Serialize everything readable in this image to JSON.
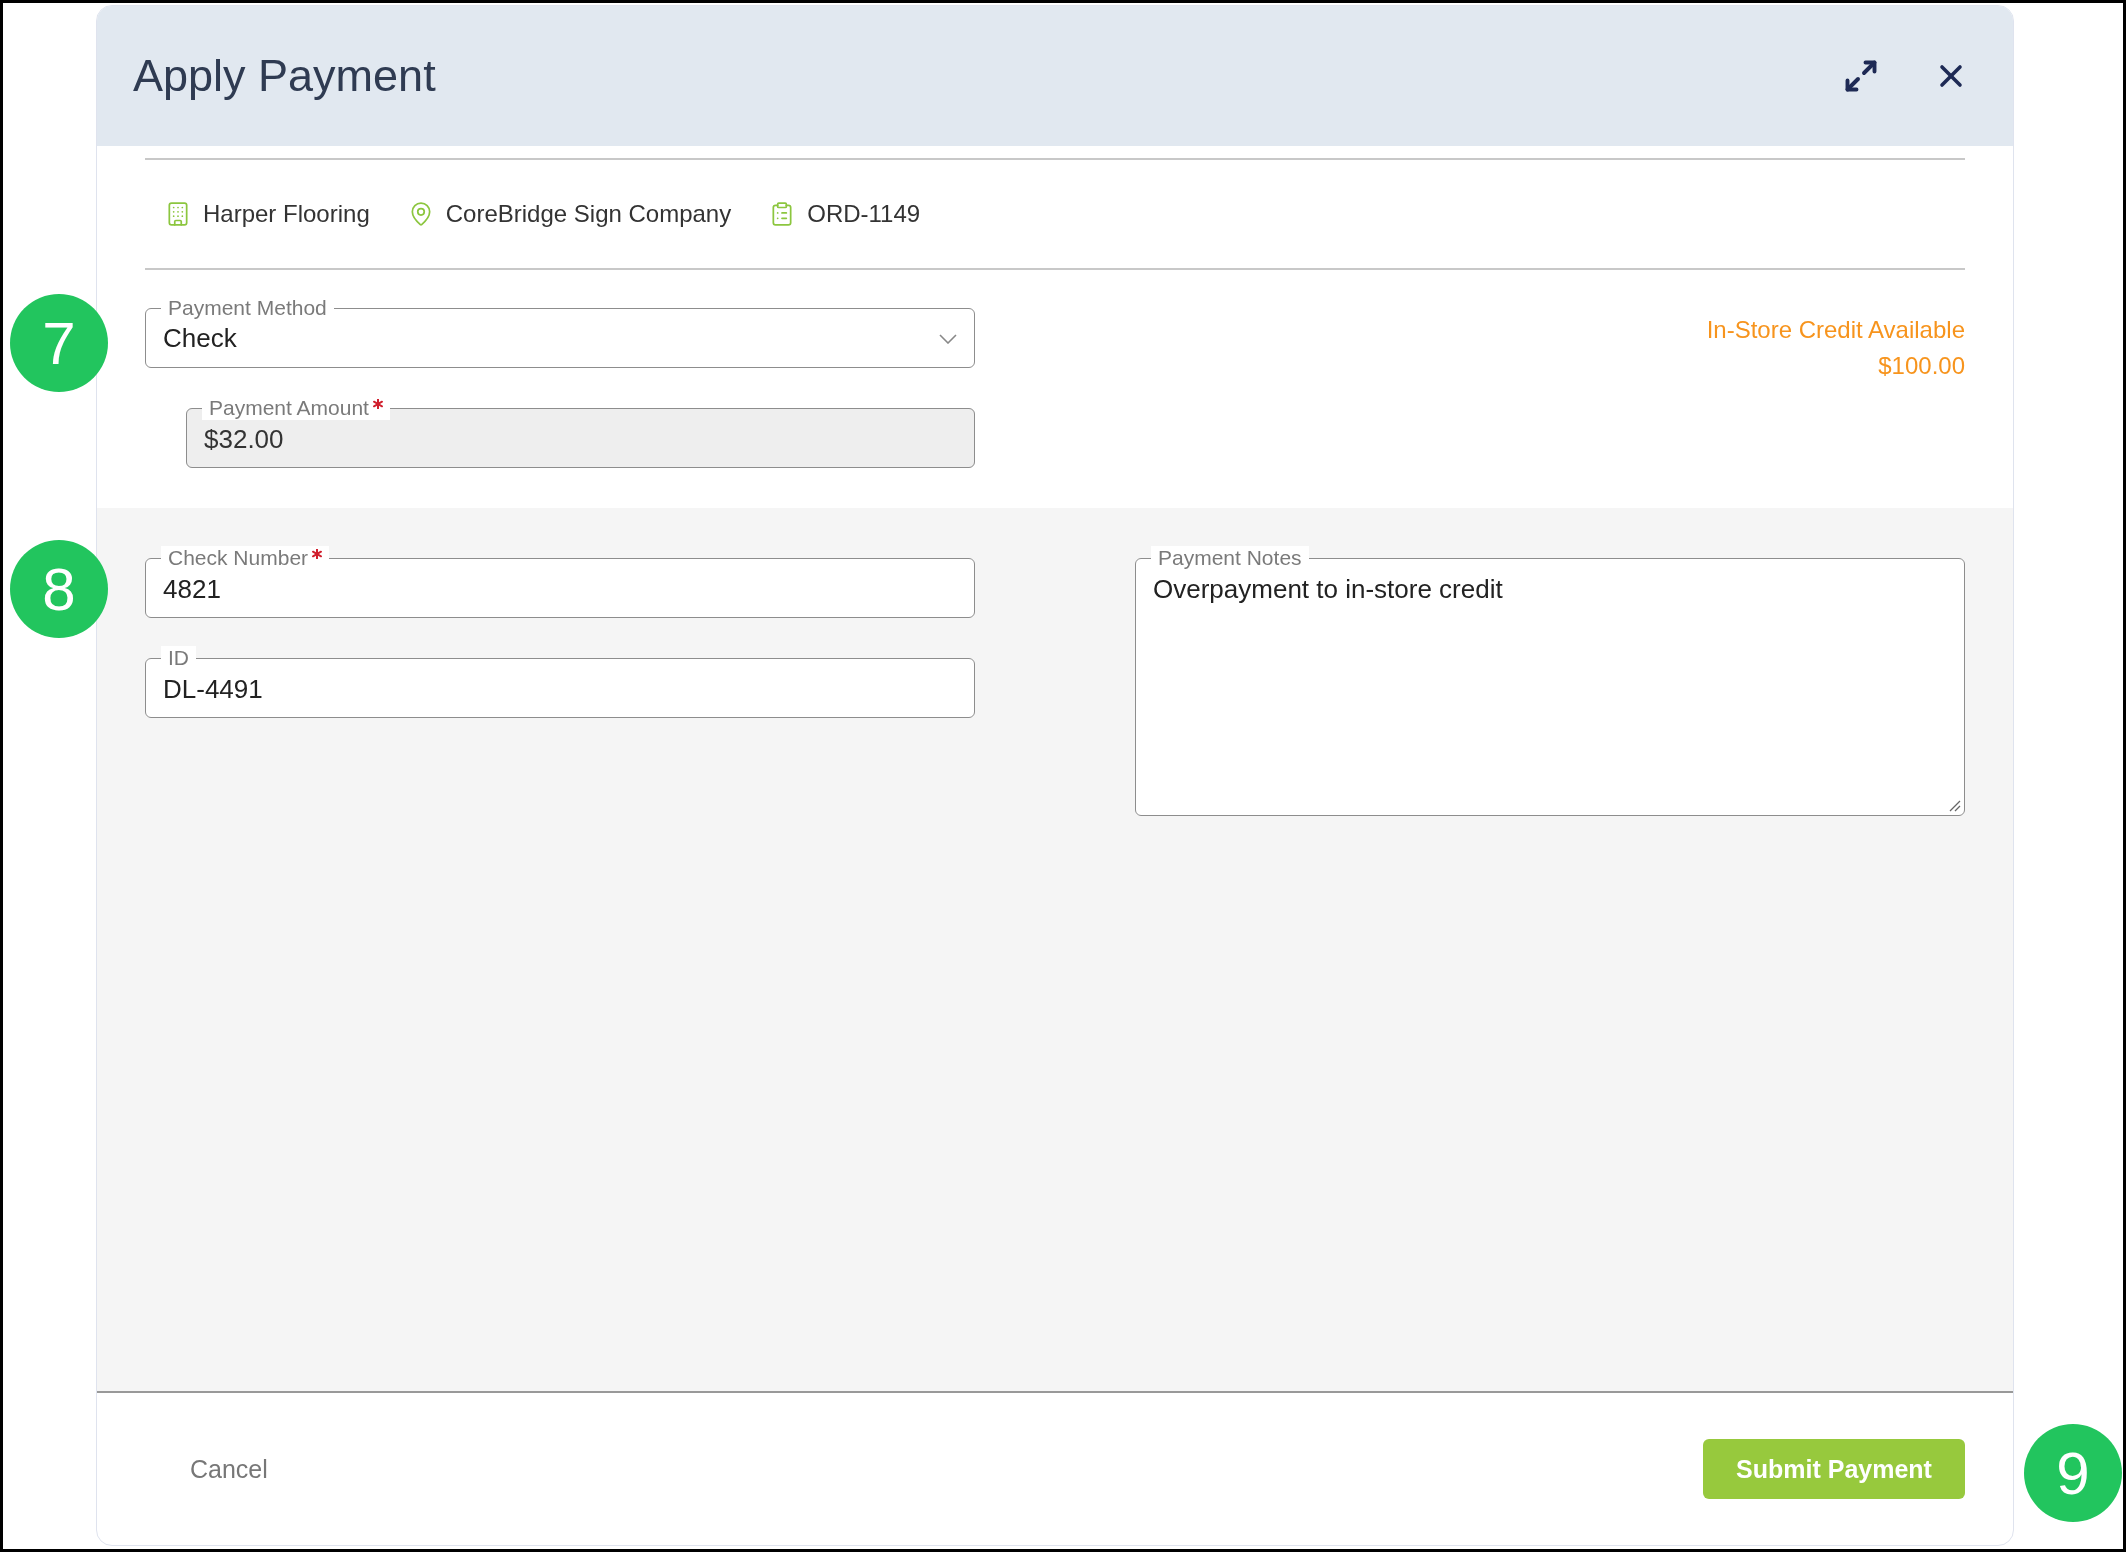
{
  "dialog": {
    "title": "Apply Payment"
  },
  "context": [
    {
      "kind": "company",
      "text": "Harper Flooring"
    },
    {
      "kind": "location",
      "text": "CoreBridge Sign Company"
    },
    {
      "kind": "order",
      "text": "ORD-1149"
    }
  ],
  "payment_method": {
    "label": "Payment Method",
    "value": "Check"
  },
  "payment_amount": {
    "label": "Payment Amount",
    "required": true,
    "disabled": true,
    "value": "$32.00"
  },
  "credit": {
    "label": "In-Store Credit Available",
    "amount": "$100.00"
  },
  "check_number": {
    "label": "Check Number",
    "required": true,
    "disabled": false,
    "value": "4821"
  },
  "id_field": {
    "label": "ID",
    "disabled": false,
    "value": "DL-4491"
  },
  "notes": {
    "label": "Payment Notes",
    "value": "Overpayment to in-store credit"
  },
  "actions": {
    "cancel": "Cancel",
    "submit": "Submit Payment"
  },
  "markers": [
    {
      "label": "7"
    },
    {
      "label": "8"
    },
    {
      "label": "9"
    }
  ]
}
